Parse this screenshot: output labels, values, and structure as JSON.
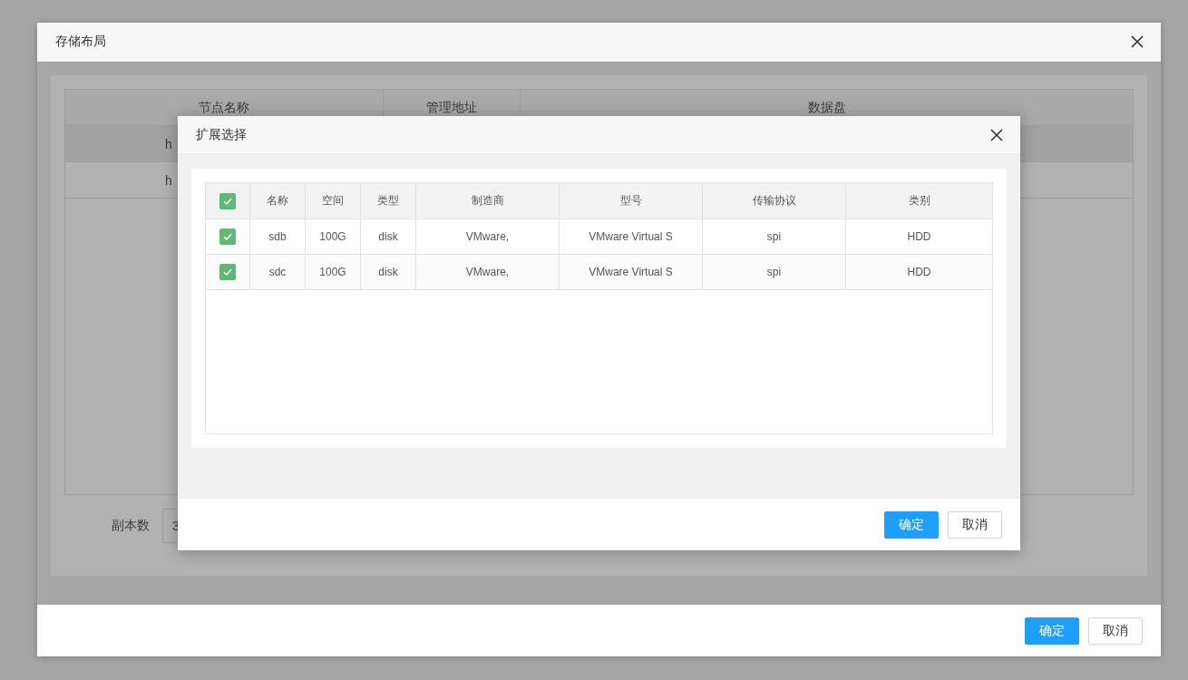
{
  "outer_dialog": {
    "title": "存储布局",
    "table": {
      "columns": [
        "节点名称",
        "管理地址",
        "数据盘"
      ],
      "rows": [
        {
          "hovered": true,
          "cells": [
            "h"
          ]
        },
        {
          "hovered": false,
          "cells": [
            "h"
          ]
        }
      ]
    },
    "replicas": {
      "label": "副本数",
      "value": "3"
    },
    "buttons": [
      "确定",
      "取消"
    ]
  },
  "inner_dialog": {
    "title": "扩展选择",
    "table": {
      "all_checked": true,
      "columns": [
        "名称",
        "空间",
        "类型",
        "制造商",
        "型号",
        "传输协议",
        "类别"
      ],
      "rows": [
        {
          "checked": true,
          "cells": [
            "sdb",
            "100G",
            "disk",
            "VMware,",
            "VMware Virtual S",
            "spi",
            "HDD"
          ]
        },
        {
          "checked": true,
          "cells": [
            "sdc",
            "100G",
            "disk",
            "VMware,",
            "VMware Virtual S",
            "spi",
            "HDD"
          ]
        }
      ]
    },
    "buttons": [
      "确定",
      "取消"
    ]
  }
}
